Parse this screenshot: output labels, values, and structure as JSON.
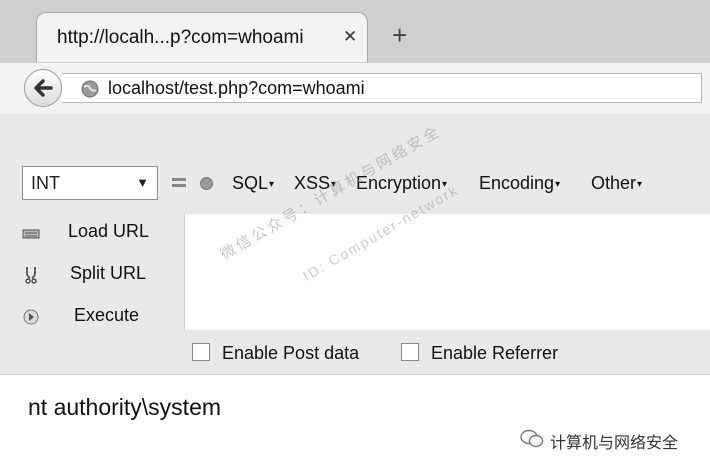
{
  "browser": {
    "tab": {
      "title": "http://localh...p?com=whoami",
      "close_glyph": "✕"
    },
    "new_tab_glyph": "+",
    "address": "localhost/test.php?com=whoami"
  },
  "hackbar": {
    "select": {
      "value": "INT",
      "arrow": "▼"
    },
    "menus": [
      "SQL",
      "XSS",
      "Encryption",
      "Encoding",
      "Other"
    ],
    "menu_caret": "▾",
    "actions": [
      {
        "label": "Load URL",
        "icon": "load-url-icon"
      },
      {
        "label": "Split URL",
        "icon": "split-url-icon"
      },
      {
        "label": "Execute",
        "icon": "execute-icon"
      }
    ],
    "options": [
      {
        "label": "Enable Post data",
        "checked": false
      },
      {
        "label": "Enable Referrer",
        "checked": false
      }
    ],
    "watermark_line1": "微信公众号：计算机与网络安全",
    "watermark_line2": "ID: Computer-network"
  },
  "page": {
    "output": "nt authority\\system"
  },
  "footer": {
    "wechat_label": "计算机与网络安全"
  },
  "colors": {
    "toolbar_bg": "#e9e9e9",
    "tabstrip_bg": "#cfcfcf"
  }
}
